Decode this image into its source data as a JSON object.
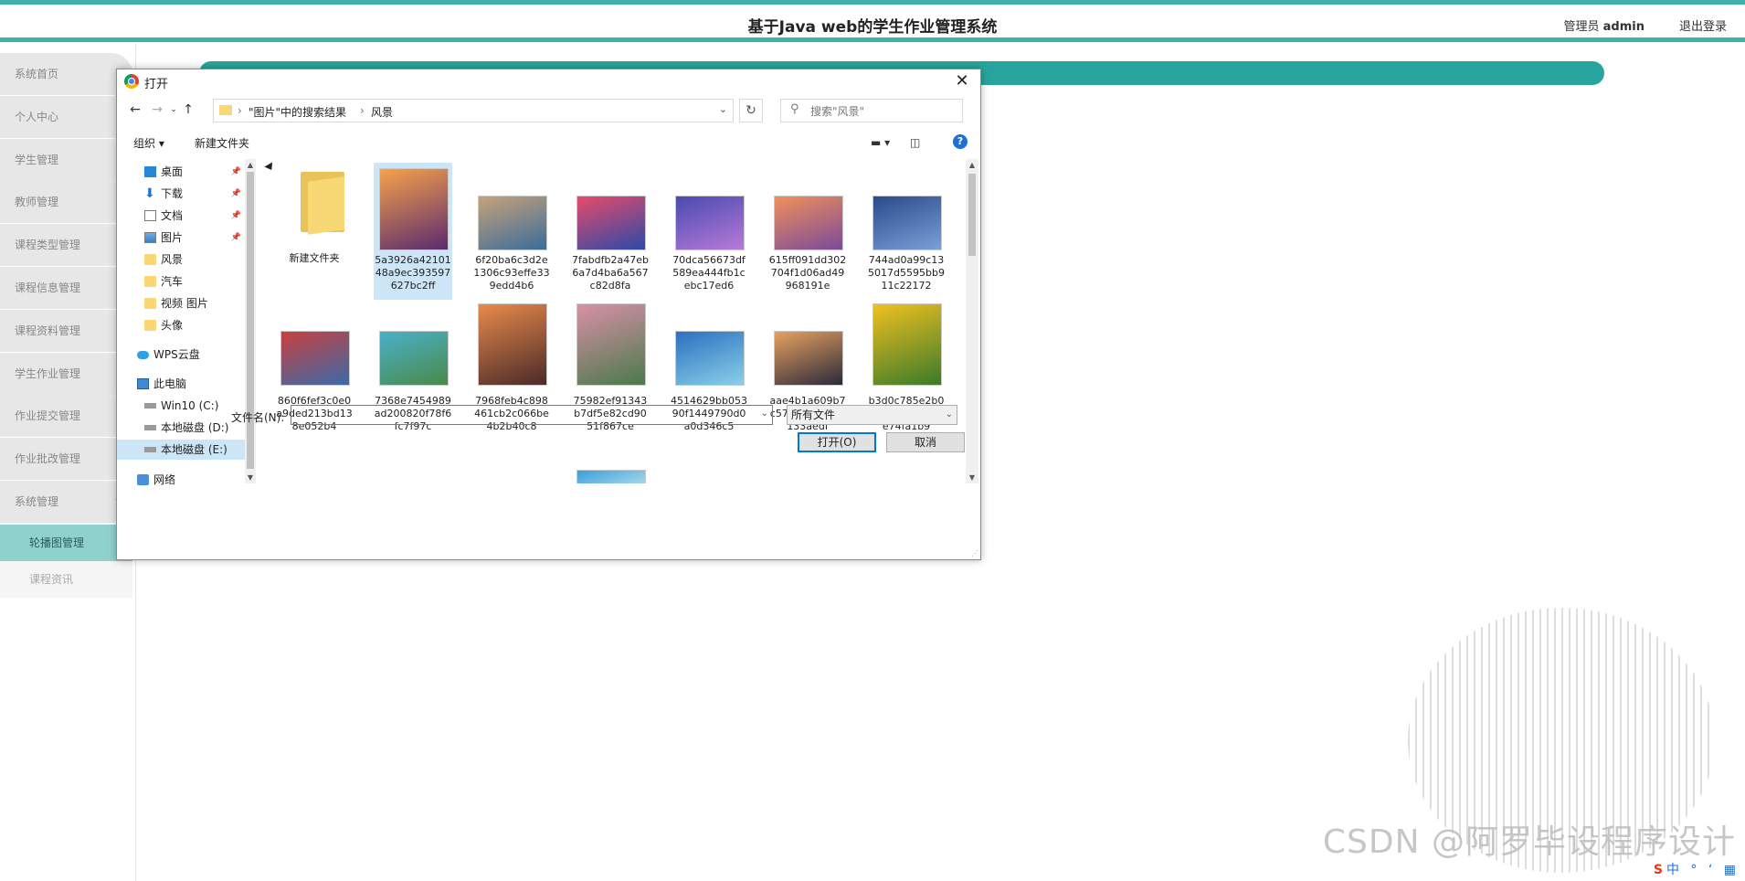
{
  "header": {
    "title": "基于Java web的学生作业管理系统",
    "user_label": "管理员",
    "user_name": "admin",
    "logout": "退出登录"
  },
  "sidebar": {
    "items": [
      {
        "label": "系统首页"
      },
      {
        "label": "个人中心"
      },
      {
        "label": "学生管理"
      },
      {
        "label": "教师管理"
      },
      {
        "label": "课程类型管理"
      },
      {
        "label": "课程信息管理"
      },
      {
        "label": "课程资料管理"
      },
      {
        "label": "学生作业管理"
      },
      {
        "label": "作业提交管理"
      },
      {
        "label": "作业批改管理"
      },
      {
        "label": "系统管理"
      }
    ],
    "sub_items": [
      {
        "label": "轮播图管理"
      },
      {
        "label": "课程资讯"
      }
    ]
  },
  "dialog": {
    "title": "打开",
    "breadcrumb": [
      "\"图片\"中的搜索结果",
      "风景"
    ],
    "search_placeholder": "搜索\"风景\"",
    "toolbar": {
      "organize": "组织 ▾",
      "new_folder": "新建文件夹"
    },
    "nav_items": [
      {
        "label": "桌面",
        "icon": "desktop-icon"
      },
      {
        "label": "下载",
        "icon": "download-icon"
      },
      {
        "label": "文档",
        "icon": "document-icon"
      },
      {
        "label": "图片",
        "icon": "pictures-icon"
      },
      {
        "label": "风景",
        "icon": "folder-icon"
      },
      {
        "label": "汽车",
        "icon": "folder-icon"
      },
      {
        "label": "视频 图片",
        "icon": "folder-icon"
      },
      {
        "label": "头像",
        "icon": "folder-icon"
      },
      {
        "label": "WPS云盘",
        "icon": "cloud-icon"
      },
      {
        "label": "此电脑",
        "icon": "computer-icon"
      },
      {
        "label": "Win10 (C:)",
        "icon": "drive-icon"
      },
      {
        "label": "本地磁盘 (D:)",
        "icon": "drive-icon"
      },
      {
        "label": "本地磁盘 (E:)",
        "icon": "drive-icon"
      },
      {
        "label": "网络",
        "icon": "network-icon"
      }
    ],
    "files": [
      {
        "name": "新建文件夹",
        "type": "folder"
      },
      {
        "name": "5a3926a4210148a9ec393597627bc2ff",
        "colors": [
          "#f7a14a",
          "#5a2a6e"
        ]
      },
      {
        "name": "6f20ba6c3d2e1306c93effe339edd4b6",
        "colors": [
          "#c7a27a",
          "#3a6c9a"
        ]
      },
      {
        "name": "7fabdfb2a47eb6a7d4ba6a567c82d8fa",
        "colors": [
          "#e84a6a",
          "#2a4aa8"
        ]
      },
      {
        "name": "70dca56673df589ea444fb1cebc17ed6",
        "colors": [
          "#4a4ab0",
          "#b87ad8"
        ]
      },
      {
        "name": "615ff091dd302704f1d06ad49968191e",
        "colors": [
          "#f0905a",
          "#7a4a9a"
        ]
      },
      {
        "name": "744ad0a99c135017d5595bb911c22172",
        "colors": [
          "#2a4a8a",
          "#7aa0d8"
        ]
      },
      {
        "name": "860f6fef3c0e0a9ded213bd138e052b4",
        "colors": [
          "#c84040",
          "#3a6aa8"
        ]
      },
      {
        "name": "7368e7454989ad200820f78f6fc7f97c",
        "colors": [
          "#4ab0c8",
          "#4a8a4a"
        ]
      },
      {
        "name": "7968feb4c898461cb2c066be4b2b40c8",
        "colors": [
          "#e88a4a",
          "#4a2a2a"
        ]
      },
      {
        "name": "75982ef91343b7df5e82cd9051f867ce",
        "colors": [
          "#d890a8",
          "#4a7a4a"
        ]
      },
      {
        "name": "4514629bb05390f1449790d0a0d346c5",
        "colors": [
          "#2a70c0",
          "#8ad0e8"
        ]
      },
      {
        "name": "aae4b1a609b7c57c9aff12536133aedf",
        "colors": [
          "#e8a060",
          "#2a2a3a"
        ]
      },
      {
        "name": "b3d0c785e2b096dbcbc75b8be74fa1b9",
        "colors": [
          "#f0c020",
          "#3a7a2a"
        ]
      },
      {
        "name": "",
        "colors": [
          "#1a1a3a",
          "#3a4a7a"
        ]
      },
      {
        "name": "",
        "colors": [
          "#d8d0c0",
          "#a8a090"
        ]
      },
      {
        "name": "",
        "colors": [
          "#1a1a4a",
          "#4a3a8a"
        ]
      },
      {
        "name": "",
        "colors": [
          "#3aa0d8",
          "#e8f4f8"
        ]
      }
    ],
    "filename_label": "文件名(N):",
    "filename_value": "",
    "filetype": "所有文件",
    "open_button": "打开(O)",
    "cancel_button": "取消"
  },
  "watermark": "CSDN @阿罗毕设程序设计",
  "ime": "中 ° ‘ ▦"
}
